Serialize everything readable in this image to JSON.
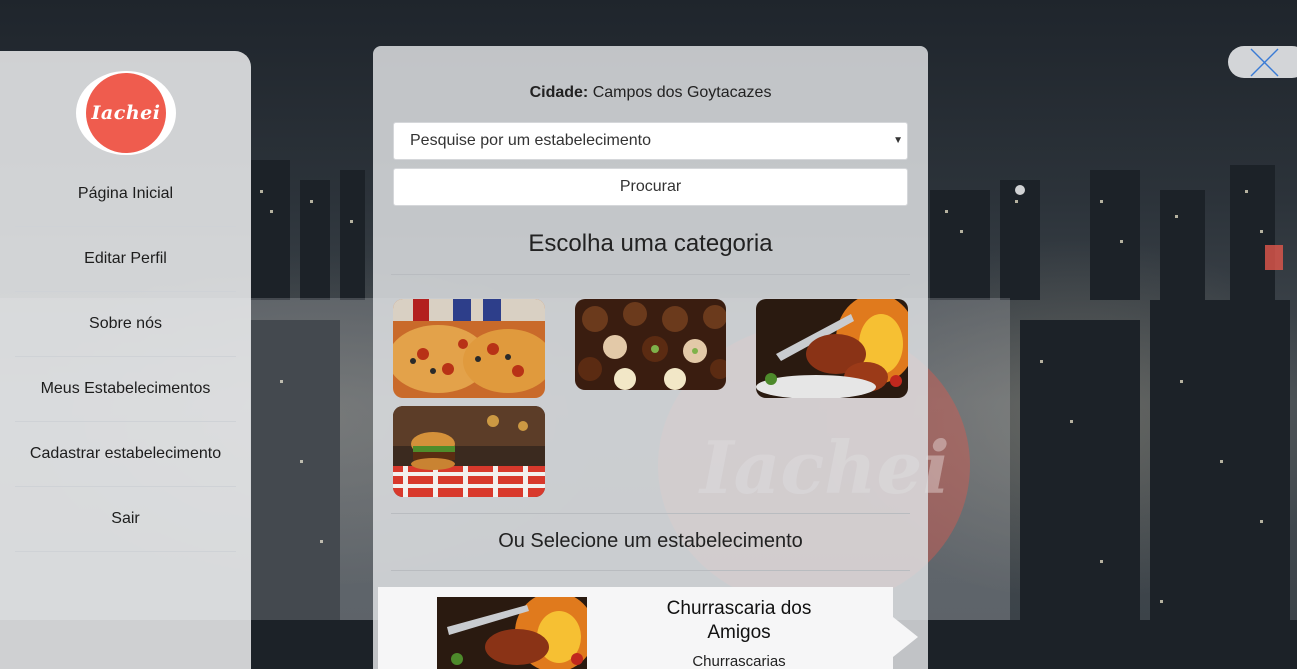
{
  "app": {
    "logo_text": "Iachei",
    "accent_color": "#ef5c4e"
  },
  "sidebar": {
    "items": [
      {
        "label": "Página Inicial"
      },
      {
        "label": "Editar Perfil"
      },
      {
        "label": "Sobre nós"
      },
      {
        "label": "Meus Estabelecimentos"
      },
      {
        "label": "Cadastrar estabelecimento"
      },
      {
        "label": "Sair"
      }
    ]
  },
  "close_icon": "close-icon",
  "search": {
    "city_label": "Cidade:",
    "city_value": "Campos dos Goytacazes",
    "select_value": "Pesquise por um estabelecimento",
    "button_label": "Procurar"
  },
  "categories": {
    "heading": "Escolha uma categoria",
    "tiles": [
      {
        "icon": "pizza-image"
      },
      {
        "icon": "chocolates-image"
      },
      {
        "icon": "barbecue-image"
      },
      {
        "icon": "burger-image"
      }
    ]
  },
  "establishments": {
    "heading": "Ou Selecione um estabelecimento",
    "items": [
      {
        "name": "Churrascaria dos Amigos",
        "category": "Churrascarias",
        "icon": "barbecue-image"
      }
    ]
  }
}
